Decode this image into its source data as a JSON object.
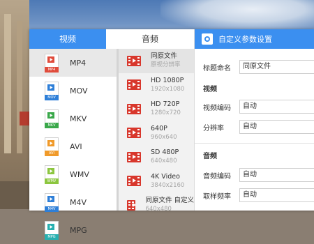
{
  "tabs": {
    "video": "视频",
    "audio": "音频"
  },
  "formats": [
    {
      "label": "MP4",
      "tag": "MP4",
      "color": "#e04c3c",
      "active": true
    },
    {
      "label": "MOV",
      "tag": "MOV",
      "color": "#2e7fd8",
      "active": false
    },
    {
      "label": "MKV",
      "tag": "MKV",
      "color": "#3aa84a",
      "active": false
    },
    {
      "label": "AVI",
      "tag": "AVI",
      "color": "#f09a2a",
      "active": false
    },
    {
      "label": "WMV",
      "tag": "WMV",
      "color": "#8cc63f",
      "active": false
    },
    {
      "label": "M4V",
      "tag": "M4V",
      "color": "#2e7fd8",
      "active": false
    },
    {
      "label": "MPG",
      "tag": "MPG",
      "color": "#27b0b0",
      "active": false
    }
  ],
  "presets": [
    {
      "name": "同原文件",
      "sub": "原视分辨率",
      "active": true
    },
    {
      "name": "HD 1080P",
      "sub": "1920x1080",
      "active": false
    },
    {
      "name": "HD 720P",
      "sub": "1280x720",
      "active": false
    },
    {
      "name": "640P",
      "sub": "960x640",
      "active": false
    },
    {
      "name": "SD 480P",
      "sub": "640x480",
      "active": false
    },
    {
      "name": "4K Video",
      "sub": "3840x2160",
      "active": false
    },
    {
      "name": "同原文件 自定义",
      "sub": "640x480",
      "active": false
    }
  ],
  "settings": {
    "title": "自定义参数设置",
    "name_label": "标题命名",
    "name_value": "同原文件",
    "video_section": "视频",
    "video_codec_label": "视频编码",
    "video_codec_value": "自动",
    "resolution_label": "分辨率",
    "resolution_value": "自动",
    "audio_section": "音频",
    "audio_codec_label": "音频编码",
    "audio_codec_value": "自动",
    "sample_rate_label": "取样频率",
    "sample_rate_value": "自动"
  },
  "colors": {
    "accent": "#3b8ff0",
    "film_icon": "#d8372c"
  }
}
